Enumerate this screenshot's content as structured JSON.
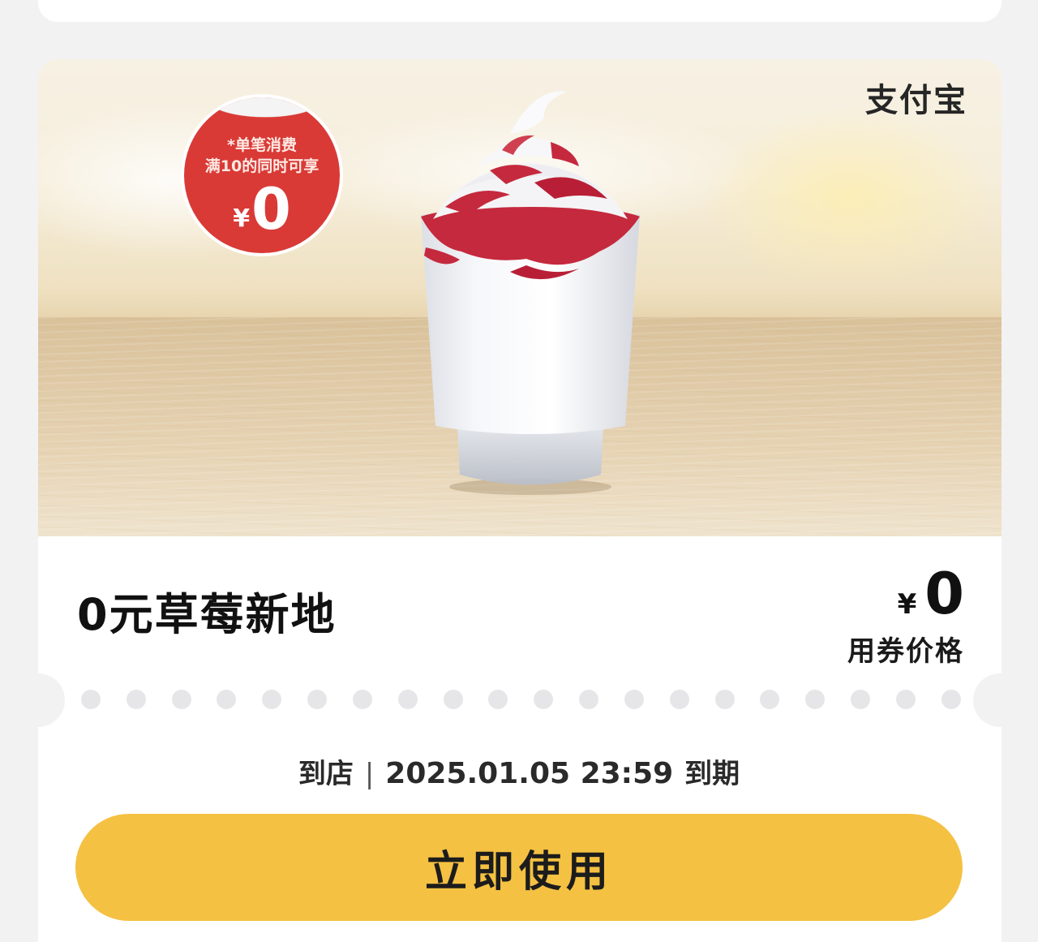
{
  "coupon": {
    "brand": "支付宝",
    "badge": {
      "line1": "*单笔消费",
      "line2": "满10的同时可享",
      "currency": "¥",
      "amount": "0"
    },
    "product_name": "0元草莓新地",
    "price": {
      "currency": "¥",
      "amount": "0",
      "label": "用券价格"
    },
    "redemption": {
      "channel": "到店",
      "separator": "|",
      "expiry_datetime": "2025.01.05 23:59",
      "expiry_suffix": "到期"
    },
    "use_button_label": "立即使用"
  },
  "colors": {
    "accent_button": "#f4c142",
    "badge_red": "#d93a36",
    "page_bg": "#f2f2f3"
  },
  "images": {
    "hero": "strawberry-sundae-product-photo"
  }
}
